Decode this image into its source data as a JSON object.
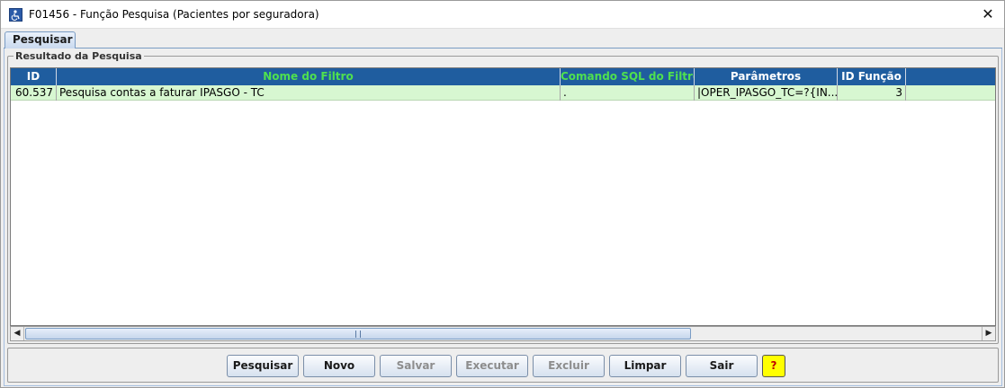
{
  "window": {
    "title": "F01456 - Função Pesquisa (Pacientes por seguradora)",
    "close_glyph": "✕",
    "app_icon": "wheelchair-app-icon"
  },
  "tabs": [
    {
      "label": "Pesquisar",
      "selected": true
    }
  ],
  "result_panel": {
    "legend": "Resultado da Pesquisa"
  },
  "table": {
    "columns": [
      {
        "label": "ID",
        "color": "#ffffff"
      },
      {
        "label": "Nome do Filtro",
        "color": "#4fe04f"
      },
      {
        "label": "Comando SQL do Filtro",
        "color": "#4fe04f"
      },
      {
        "label": "Parâmetros",
        "color": "#ffffff"
      },
      {
        "label": "ID Função",
        "color": "#ffffff"
      }
    ],
    "rows": [
      {
        "id": "60.537",
        "nome": "Pesquisa contas a faturar IPASGO - TC",
        "comando": ".",
        "parametros": "|OPER_IPASGO_TC=?{IN...",
        "id_funcao": "3"
      }
    ],
    "header_bg": "#1f5d9f",
    "row_bg": "#d7f7d1"
  },
  "buttons": {
    "pesquisar": "Pesquisar",
    "novo": "Novo",
    "salvar": "Salvar",
    "executar": "Executar",
    "excluir": "Excluir",
    "limpar": "Limpar",
    "sair": "Sair",
    "help": "?"
  },
  "colors": {
    "help_bg": "#ffff00",
    "tab_border": "#7a9cc4"
  }
}
